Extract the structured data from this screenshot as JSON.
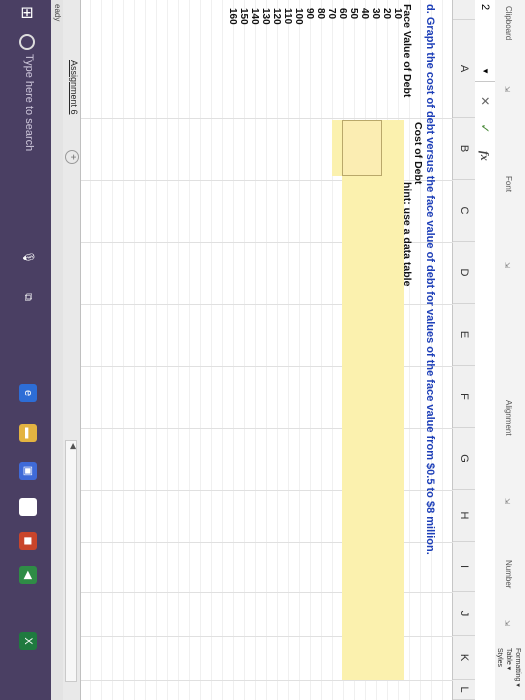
{
  "ribbon": {
    "clipboard_label": "Clipboard",
    "font_label": "Font",
    "alignment_label": "Alignment",
    "number_label": "Number",
    "formatting_label": "Formatting ▾",
    "table_label": "Table ▾",
    "styles_label": "Styles"
  },
  "formula_bar": {
    "name_box": "2",
    "cancel_symbol": "✕",
    "enter_symbol": "✓",
    "fx_label": "fx"
  },
  "columns": [
    "A",
    "B",
    "C",
    "D",
    "E",
    "F",
    "G",
    "H",
    "I",
    "J",
    "K",
    "L"
  ],
  "sheet": {
    "title": "d. Graph the cost of debt versus the face value of debt for values of the face value from $0.5 to $8 million.",
    "cost_of_debt_header": "Cost of Debt",
    "face_value_header": "Face Value of Debt",
    "hint": "hint:  use a data table",
    "face_values": [
      "10",
      "20",
      "30",
      "40",
      "50",
      "60",
      "70",
      "80",
      "90",
      "100",
      "110",
      "120",
      "130",
      "140",
      "150",
      "160"
    ]
  },
  "tabs": {
    "active": "Assignment 6",
    "add_symbol": "+"
  },
  "status": {
    "text": "eady"
  },
  "taskbar": {
    "search_placeholder": "Type here to search",
    "store_letter": "a"
  },
  "colors": {
    "title_blue": "#1d3fb8",
    "input_yellow": "#fbf1ae",
    "taskbar": "#4a3f63"
  }
}
